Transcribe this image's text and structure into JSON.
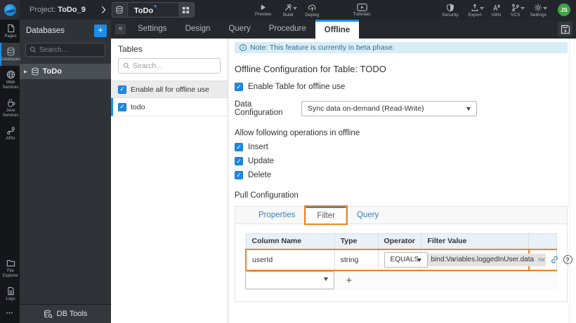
{
  "colors": {
    "accent_blue": "#1b8ce8",
    "annotation_orange": "#f0831f",
    "note_bg": "#d9edf7",
    "note_text": "#31708f",
    "avatar_green": "#43a047",
    "topbar_bg": "#22262b"
  },
  "icons": {
    "check": "✓",
    "close": "×",
    "collapse_left": "«",
    "tree_caret": "▶",
    "more_dots": "•••",
    "help": "?",
    "info": "i",
    "modified": "*",
    "add": "+",
    "delete": "×"
  },
  "topbar": {
    "project_prefix": "Project:",
    "project_name": "ToDo_9",
    "service_tab_name": "ToDo",
    "preview": "Preview",
    "build": "Build",
    "deploy": "Deploy",
    "tutorials": "Tutorials",
    "security": "Security",
    "export": "Export",
    "i18n": "I18N",
    "vcs": "VCS",
    "settings": "Settings",
    "avatar_initials": "JS"
  },
  "left_rail": {
    "items": [
      {
        "label": "Pages"
      },
      {
        "label": "Databases",
        "active": true
      },
      {
        "label": "Web Services"
      },
      {
        "label": "Java Services"
      },
      {
        "label": "APIs"
      }
    ],
    "bottom_items": [
      {
        "label": "File Explorer"
      },
      {
        "label": "Logs"
      }
    ]
  },
  "db_panel": {
    "title": "Databases",
    "search_placeholder": "Search...",
    "database_name": "ToDo",
    "db_tools_label": "DB Tools"
  },
  "editor_tabs": {
    "tabs": [
      "Settings",
      "Design",
      "Query",
      "Procedure",
      "Offline"
    ],
    "active": "Offline"
  },
  "tables_panel": {
    "title": "Tables",
    "search_placeholder": "Search...",
    "enable_all_label": "Enable all for offline use",
    "table_name": "todo"
  },
  "main": {
    "note": "Note: This feature is currently in beta phase.",
    "heading": "Offline Configuration for Table: TODO",
    "enable_table_label": "Enable Table for offline use",
    "data_config_label": "Data Configuration",
    "data_config_value": "Sync data on-demand (Read-Write)",
    "operations_label": "Allow following operations in offline",
    "operations": [
      {
        "label": "Insert",
        "checked": true
      },
      {
        "label": "Update",
        "checked": true
      },
      {
        "label": "Delete",
        "checked": true
      }
    ],
    "pull_config_label": "Pull Configuration",
    "pull_tabs": [
      "Properties",
      "Filter",
      "Query"
    ],
    "pull_active_tab": "Filter",
    "filter_table": {
      "headers": [
        "Column Name",
        "Type",
        "Operator",
        "Filter Value"
      ],
      "row": {
        "column_name": "userId",
        "type": "string",
        "operator": "EQUALS",
        "filter_value": "bind:Variables.loggedInUser.data"
      }
    }
  }
}
